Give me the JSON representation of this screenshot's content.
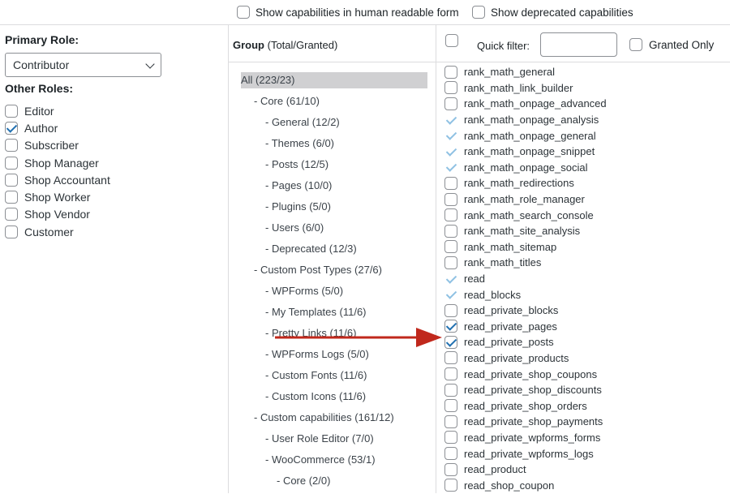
{
  "top_options": {
    "human_readable": {
      "label": "Show capabilities in human readable form",
      "checked": false
    },
    "deprecated": {
      "label": "Show deprecated capabilities",
      "checked": false
    }
  },
  "left": {
    "primary_role_label": "Primary Role:",
    "primary_role_value": "Contributor",
    "other_roles_label": "Other Roles:",
    "other_roles": [
      {
        "label": "Editor",
        "checked": false
      },
      {
        "label": "Author",
        "checked": true
      },
      {
        "label": "Subscriber",
        "checked": false
      },
      {
        "label": "Shop Manager",
        "checked": false
      },
      {
        "label": "Shop Accountant",
        "checked": false
      },
      {
        "label": "Shop Worker",
        "checked": false
      },
      {
        "label": "Shop Vendor",
        "checked": false
      },
      {
        "label": "Customer",
        "checked": false
      }
    ]
  },
  "groups": {
    "header_bold": "Group",
    "header_suffix": " (Total/Granted)",
    "items": [
      {
        "label": "All (223/23)",
        "level": 0,
        "selected": true
      },
      {
        "label": "- Core (61/10)",
        "level": 1
      },
      {
        "label": "- General (12/2)",
        "level": 2
      },
      {
        "label": "- Themes (6/0)",
        "level": 2
      },
      {
        "label": "- Posts (12/5)",
        "level": 2
      },
      {
        "label": "- Pages (10/0)",
        "level": 2
      },
      {
        "label": "- Plugins (5/0)",
        "level": 2
      },
      {
        "label": "- Users (6/0)",
        "level": 2
      },
      {
        "label": "- Deprecated (12/3)",
        "level": 2
      },
      {
        "label": "- Custom Post Types (27/6)",
        "level": 1
      },
      {
        "label": "- WPForms (5/0)",
        "level": 2
      },
      {
        "label": "- My Templates (11/6)",
        "level": 2
      },
      {
        "label": "- Pretty Links (11/6)",
        "level": 2
      },
      {
        "label": "- WPForms Logs (5/0)",
        "level": 2
      },
      {
        "label": "- Custom Fonts (11/6)",
        "level": 2
      },
      {
        "label": "- Custom Icons (11/6)",
        "level": 2
      },
      {
        "label": "- Custom capabilities (161/12)",
        "level": 1
      },
      {
        "label": "- User Role Editor (7/0)",
        "level": 2
      },
      {
        "label": "- WooCommerce (53/1)",
        "level": 2
      },
      {
        "label": "- Core (2/0)",
        "level": 3
      }
    ]
  },
  "caps": {
    "quick_filter_label": "Quick filter:",
    "quick_filter_value": "",
    "granted_only_label": "Granted Only",
    "items": [
      {
        "label": "rank_math_general",
        "state": "unchecked"
      },
      {
        "label": "rank_math_link_builder",
        "state": "unchecked"
      },
      {
        "label": "rank_math_onpage_advanced",
        "state": "unchecked"
      },
      {
        "label": "rank_math_onpage_analysis",
        "state": "inherited"
      },
      {
        "label": "rank_math_onpage_general",
        "state": "inherited"
      },
      {
        "label": "rank_math_onpage_snippet",
        "state": "inherited"
      },
      {
        "label": "rank_math_onpage_social",
        "state": "inherited"
      },
      {
        "label": "rank_math_redirections",
        "state": "unchecked"
      },
      {
        "label": "rank_math_role_manager",
        "state": "unchecked"
      },
      {
        "label": "rank_math_search_console",
        "state": "unchecked"
      },
      {
        "label": "rank_math_site_analysis",
        "state": "unchecked"
      },
      {
        "label": "rank_math_sitemap",
        "state": "unchecked"
      },
      {
        "label": "rank_math_titles",
        "state": "unchecked"
      },
      {
        "label": "read",
        "state": "inherited"
      },
      {
        "label": "read_blocks",
        "state": "inherited"
      },
      {
        "label": "read_private_blocks",
        "state": "unchecked"
      },
      {
        "label": "read_private_pages",
        "state": "checked"
      },
      {
        "label": "read_private_posts",
        "state": "checked"
      },
      {
        "label": "read_private_products",
        "state": "unchecked"
      },
      {
        "label": "read_private_shop_coupons",
        "state": "unchecked"
      },
      {
        "label": "read_private_shop_discounts",
        "state": "unchecked"
      },
      {
        "label": "read_private_shop_orders",
        "state": "unchecked"
      },
      {
        "label": "read_private_shop_payments",
        "state": "unchecked"
      },
      {
        "label": "read_private_wpforms_forms",
        "state": "unchecked"
      },
      {
        "label": "read_private_wpforms_logs",
        "state": "unchecked"
      },
      {
        "label": "read_product",
        "state": "unchecked"
      },
      {
        "label": "read_shop_coupon",
        "state": "unchecked"
      }
    ]
  },
  "annotation": {
    "arrow_color": "#c0281c"
  }
}
